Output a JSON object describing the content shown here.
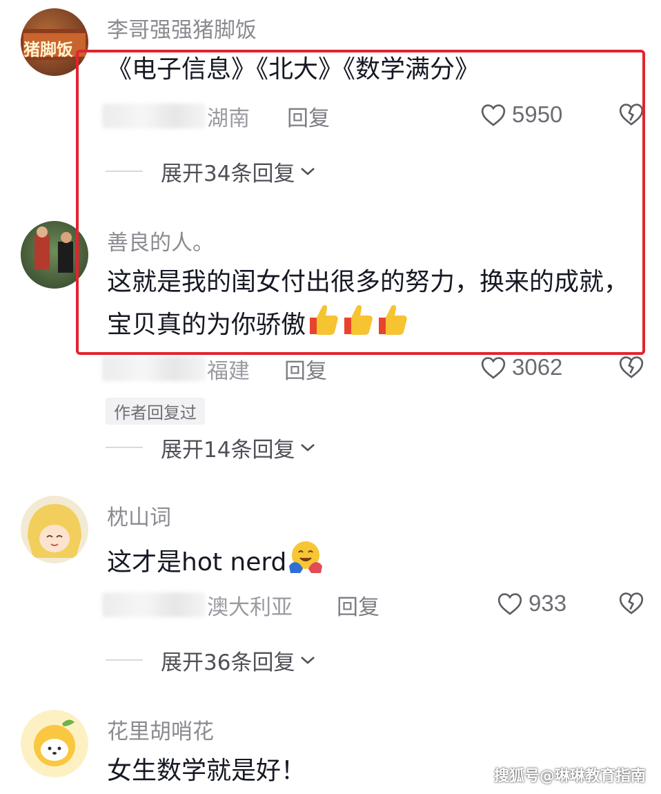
{
  "comments": [
    {
      "username": "李哥强强猪脚饭",
      "avatar_text": "猪脚饭",
      "text": "《电子信息》《北大》《数学满分》",
      "location": "湖南",
      "reply_label": "回复",
      "likes": "5950",
      "expand_label": "展开34条回复"
    },
    {
      "username": "善良的人。",
      "text": "这就是我的闺女付出很多的努力，换来的成就，宝贝真的为你骄傲",
      "emoji": "thumbs-up-icon",
      "location": "福建",
      "reply_label": "回复",
      "likes": "3062",
      "author_tag": "作者回复过",
      "expand_label": "展开14条回复"
    },
    {
      "username": "枕山词",
      "text": "这才是hot nerd",
      "emoji": "hugging-face-icon",
      "location": "澳大利亚",
      "reply_label": "回复",
      "likes": "933",
      "expand_label": "展开36条回复"
    },
    {
      "username": "花里胡哨花",
      "text": "女生数学就是好！"
    }
  ],
  "watermark": "搜狐号@琳琳教育指南",
  "colors": {
    "highlight_border": "#e2232f",
    "username": "#8a8b91",
    "text": "#161823",
    "meta": "#7d7e84"
  }
}
